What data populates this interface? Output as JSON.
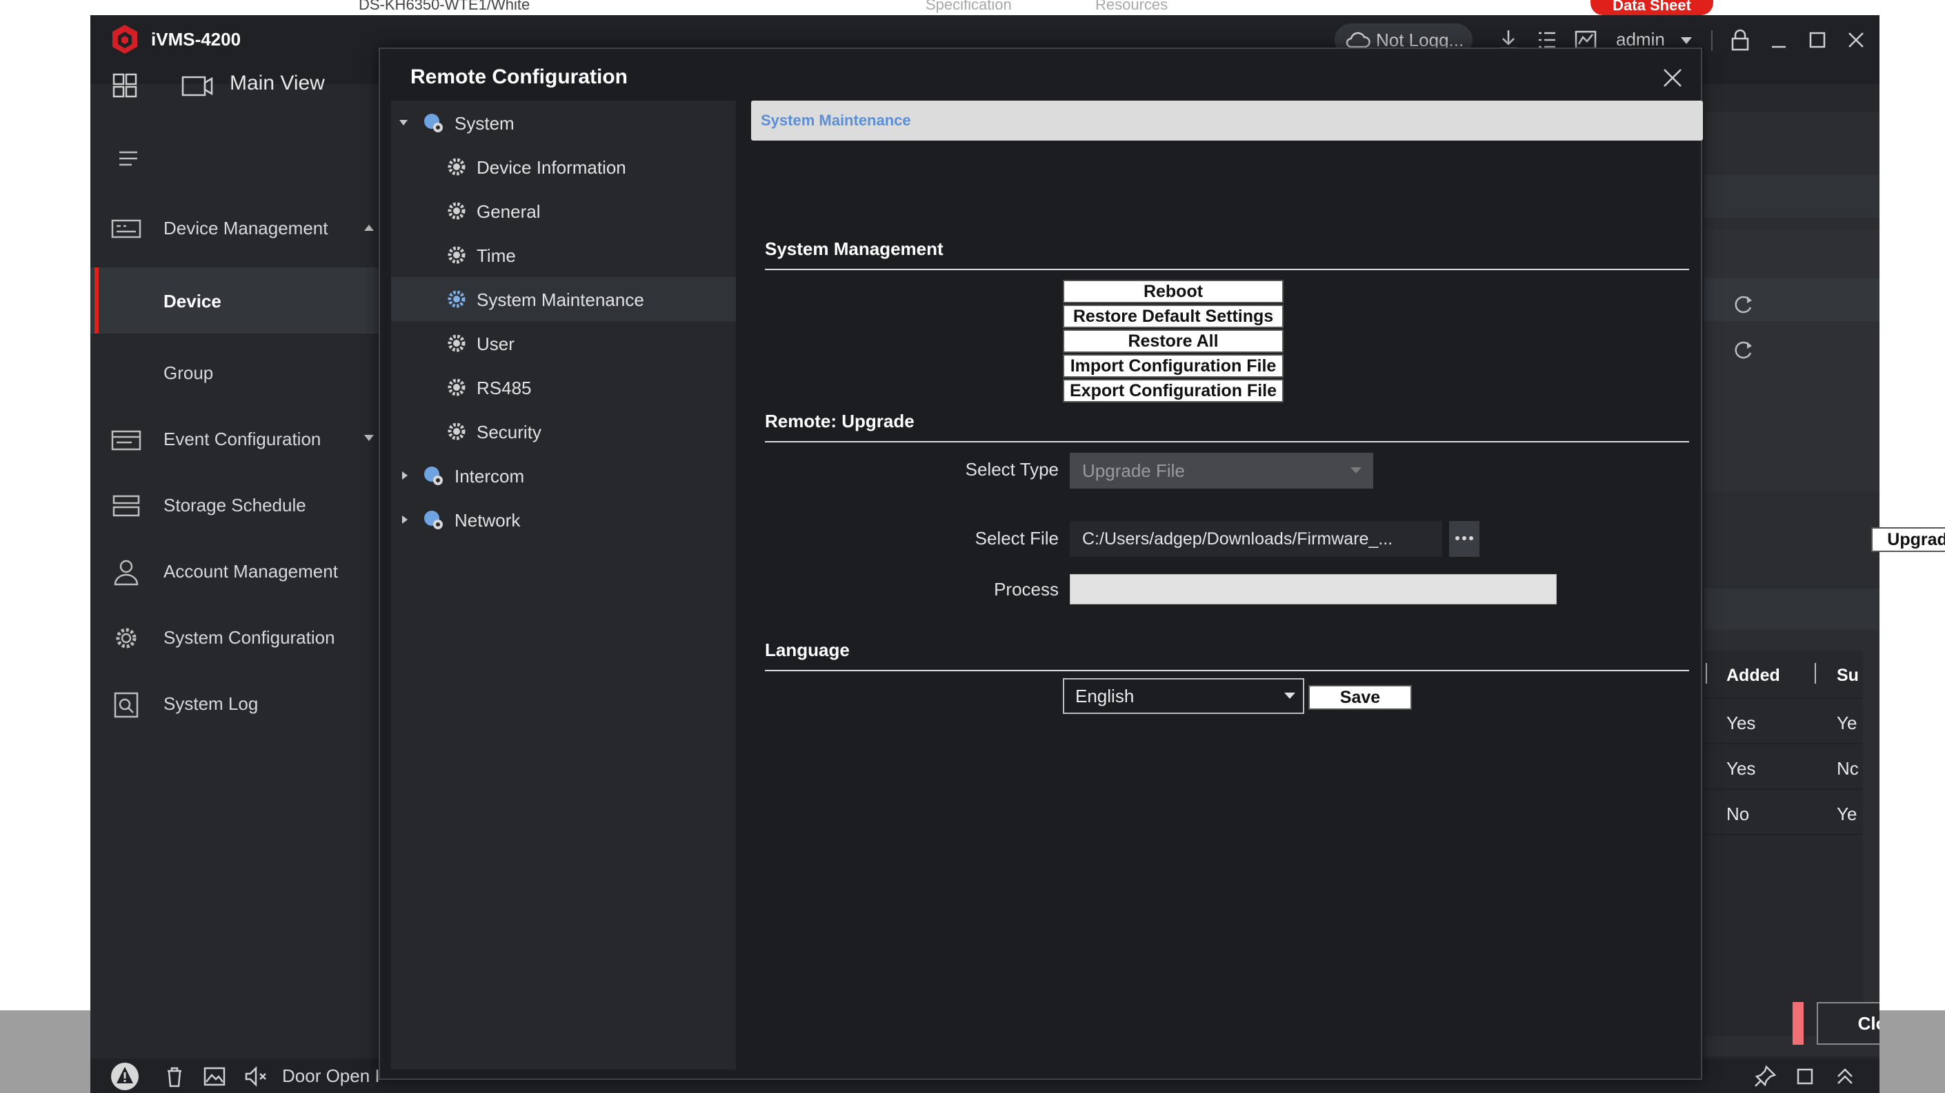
{
  "web": {
    "model": "DS-KH6350-WTE1/White",
    "tab_specification": "Specification",
    "tab_resources": "Resources",
    "datasheet_label": "Data Sheet"
  },
  "app": {
    "title": "iVMS-4200",
    "cloud_status": "Not Logg...",
    "user": "admin",
    "main_view_label": "Main View",
    "accent_color": "#e0201b"
  },
  "sidebar": {
    "items": [
      {
        "label": "Device Management",
        "icon": "device-management-icon"
      },
      {
        "label": "Device"
      },
      {
        "label": "Group"
      },
      {
        "label": "Event Configuration",
        "icon": "event-configuration-icon"
      },
      {
        "label": "Storage Schedule",
        "icon": "storage-schedule-icon"
      },
      {
        "label": "Account Management",
        "icon": "account-icon"
      },
      {
        "label": "System Configuration",
        "icon": "gear-icon"
      },
      {
        "label": "System Log",
        "icon": "log-icon"
      }
    ]
  },
  "statusbar": {
    "text": "Door Open I"
  },
  "background_table": {
    "headers": [
      "Added",
      "Su"
    ],
    "rows": [
      [
        "Yes",
        "Ye"
      ],
      [
        "Yes",
        "Nc"
      ],
      [
        "No",
        "Ye"
      ]
    ],
    "close_label": "Close"
  },
  "dialog": {
    "title": "Remote Configuration",
    "tree": [
      {
        "label": "System"
      },
      {
        "label": "Device Information"
      },
      {
        "label": "General"
      },
      {
        "label": "Time"
      },
      {
        "label": "System Maintenance"
      },
      {
        "label": "User"
      },
      {
        "label": "RS485"
      },
      {
        "label": "Security"
      },
      {
        "label": "Intercom"
      },
      {
        "label": "Network"
      }
    ],
    "breadcrumb": "System Maintenance",
    "system_management": {
      "title": "System Management",
      "buttons": [
        "Reboot",
        "Restore Default Settings",
        "Restore All",
        "Import Configuration File",
        "Export Configuration File"
      ]
    },
    "upgrade": {
      "title": "Remote: Upgrade",
      "select_type_label": "Select Type",
      "select_type_value": "Upgrade File",
      "select_file_label": "Select File",
      "select_file_value": "C:/Users/adgep/Downloads/Firmware_...",
      "upgrade_button": "Upgrade",
      "process_label": "Process"
    },
    "language": {
      "title": "Language",
      "value": "English",
      "save_button": "Save"
    }
  }
}
